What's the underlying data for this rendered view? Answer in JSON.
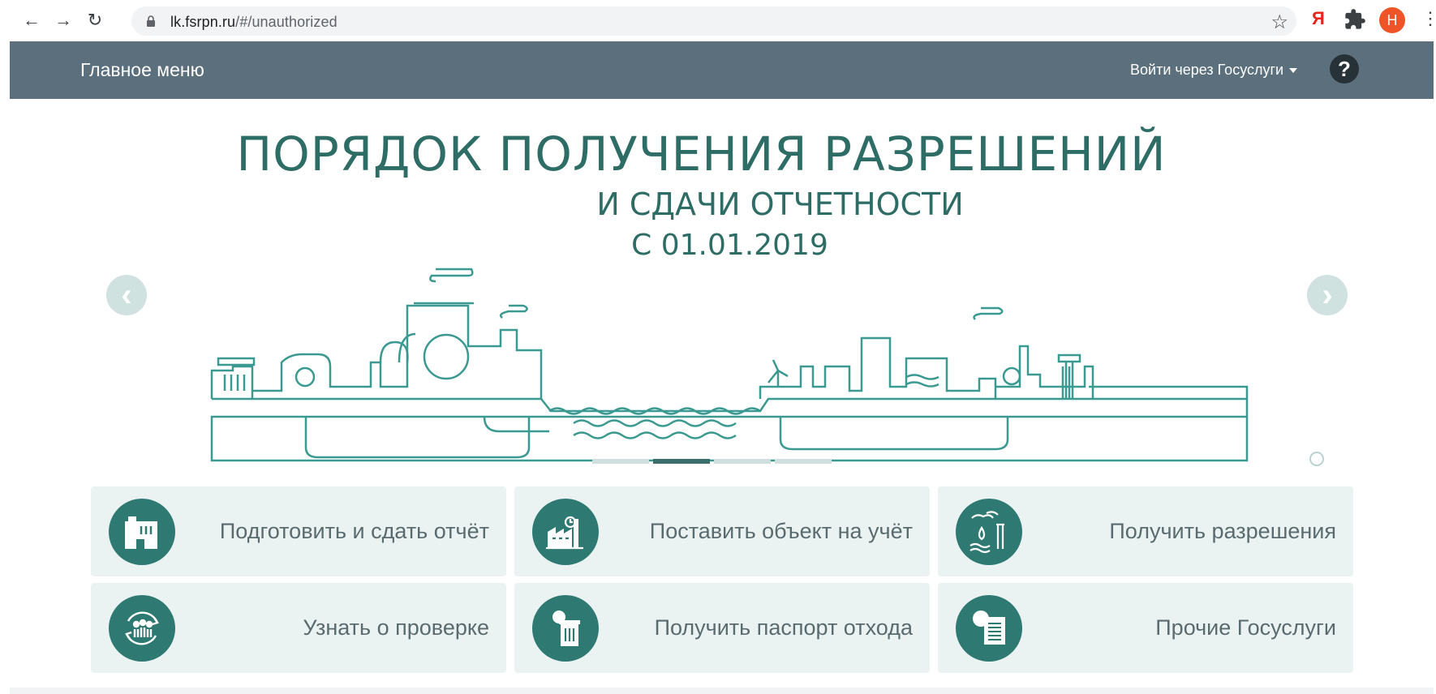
{
  "browser": {
    "url_host": "lk.fsrpn.ru",
    "url_path": "/#/unauthorized",
    "extension_ya": "Я",
    "profile_initial": "H"
  },
  "header": {
    "title": "Главное меню",
    "login_label": "Войти через Госуслуги",
    "help_label": "?"
  },
  "banner": {
    "line1": "ПОРЯДОК ПОЛУЧЕНИЯ РАЗРЕШЕНИЙ",
    "line2": "И СДАЧИ ОТЧЕТНОСТИ",
    "line3": "С 01.01.2019",
    "slide_count": 4,
    "active_slide": 2
  },
  "tiles": [
    {
      "label": "Подготовить и сдать отчёт",
      "icon": "factory-report-icon"
    },
    {
      "label": "Поставить объект на учёт",
      "icon": "factory-register-icon"
    },
    {
      "label": "Получить разрешения",
      "icon": "water-emission-icon"
    },
    {
      "label": "Узнать о проверке",
      "icon": "inspection-people-icon"
    },
    {
      "label": "Получить паспорт отхода",
      "icon": "waste-passport-icon"
    },
    {
      "label": "Прочие Госуслуги",
      "icon": "emblem-document-icon"
    }
  ],
  "colors": {
    "header_bg": "#5b6f7c",
    "accent": "#2e7a73",
    "tile_bg": "#ebf3f2",
    "banner_text": "#2e6d66"
  }
}
